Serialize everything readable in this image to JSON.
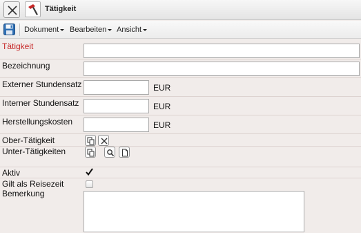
{
  "window": {
    "title": "Tätigkeit",
    "close_icon": "close-x-icon",
    "app_icon": "hammer-icon"
  },
  "menubar": {
    "save_icon": "floppy-disk-icon",
    "items": [
      {
        "label": "Dokument"
      },
      {
        "label": "Bearbeiten"
      },
      {
        "label": "Ansicht"
      }
    ]
  },
  "form": {
    "taetigkeit": {
      "label": "Tätigkeit",
      "value": "",
      "required": true,
      "label_color": "#c62828"
    },
    "bezeichnung": {
      "label": "Bezeichnung",
      "value": ""
    },
    "externer_stundensatz": {
      "label": "Externer Stundensatz",
      "value": "",
      "unit": "EUR"
    },
    "interner_stundensatz": {
      "label": "Interner Stundensatz",
      "value": "",
      "unit": "EUR"
    },
    "herstellungskosten": {
      "label": "Herstellungskosten",
      "value": "",
      "unit": "EUR"
    },
    "ober_taetigkeit": {
      "label": "Ober-Tätigkeit",
      "buttons": [
        "copy-icon",
        "clear-x-icon"
      ]
    },
    "unter_taetigkeiten": {
      "label": "Unter-Tätigkeiten",
      "buttons": [
        "copy-icon",
        "search-icon",
        "document-icon"
      ]
    },
    "aktiv": {
      "label": "Aktiv",
      "checked": true
    },
    "reisezeit": {
      "label": "Gilt als Reisezeit",
      "checked": false
    },
    "bemerkung": {
      "label": "Bemerkung",
      "value": ""
    }
  }
}
